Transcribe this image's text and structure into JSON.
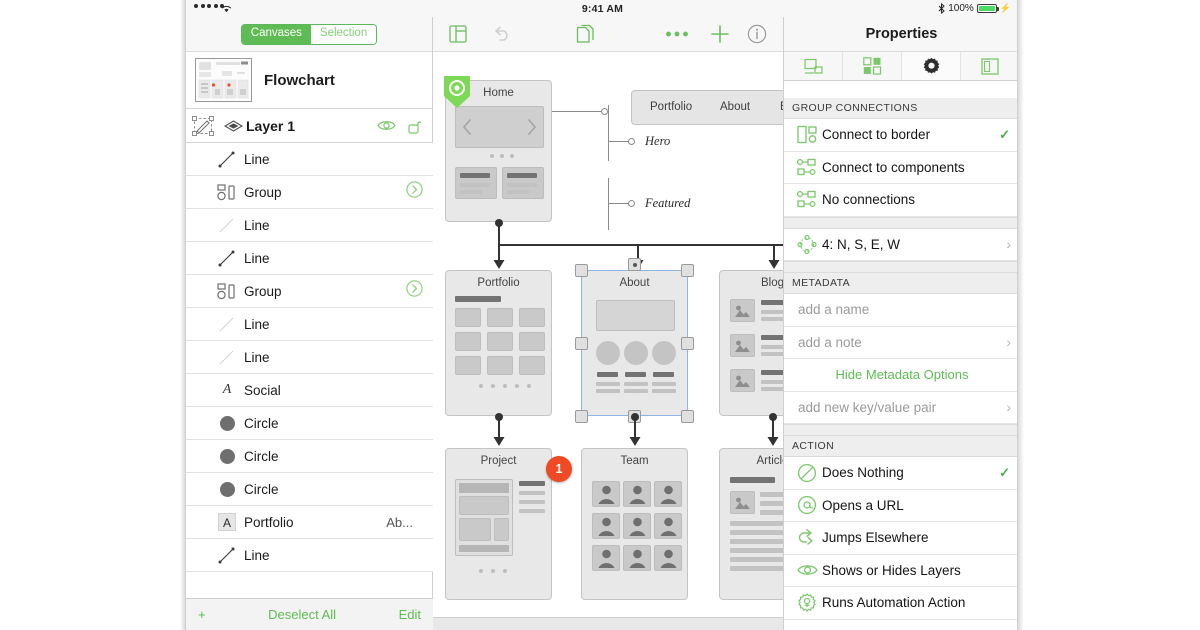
{
  "status_bar": {
    "signal_dots": 5,
    "wifi_icon": "wifi-icon",
    "time": "9:41 AM",
    "bluetooth_icon": "bluetooth-icon",
    "battery_percent": "100%",
    "charging_icon": "lightning-bolt-icon"
  },
  "sidebar": {
    "segmented": {
      "canvases": "Canvases",
      "selection": "Selection",
      "active": "Canvases"
    },
    "canvas": {
      "title": "Flowchart",
      "thumbnail_icon": "canvas-thumbnail"
    },
    "layer": {
      "name": "Layer 1",
      "select_icon": "layer-select-icon",
      "visibility_icon": "eye-icon",
      "lock_icon": "unlocked-padlock-icon"
    },
    "items": [
      {
        "label": "Line",
        "icon": "line-icon",
        "disclosure": false,
        "dim": false,
        "sub": ""
      },
      {
        "label": "Group",
        "icon": "group-icon",
        "disclosure": true,
        "dim": false,
        "sub": ""
      },
      {
        "label": "Line",
        "icon": "line-icon",
        "disclosure": false,
        "dim": true,
        "sub": ""
      },
      {
        "label": "Line",
        "icon": "line-icon",
        "disclosure": false,
        "dim": false,
        "sub": ""
      },
      {
        "label": "Group",
        "icon": "group-icon",
        "disclosure": true,
        "dim": false,
        "sub": ""
      },
      {
        "label": "Line",
        "icon": "line-icon",
        "disclosure": false,
        "dim": true,
        "sub": ""
      },
      {
        "label": "Line",
        "icon": "line-icon",
        "disclosure": false,
        "dim": true,
        "sub": ""
      },
      {
        "label": "Social",
        "icon": "text-italic-icon",
        "disclosure": false,
        "dim": false,
        "sub": ""
      },
      {
        "label": "Circle",
        "icon": "circle-icon",
        "disclosure": false,
        "dim": false,
        "sub": ""
      },
      {
        "label": "Circle",
        "icon": "circle-icon",
        "disclosure": false,
        "dim": false,
        "sub": ""
      },
      {
        "label": "Circle",
        "icon": "circle-icon",
        "disclosure": false,
        "dim": false,
        "sub": ""
      },
      {
        "label": "Portfolio",
        "icon": "text-box-icon",
        "disclosure": false,
        "dim": false,
        "sub": "Ab..."
      },
      {
        "label": "Line",
        "icon": "line-icon",
        "disclosure": false,
        "dim": false,
        "sub": ""
      }
    ],
    "footer": {
      "add_label": "+",
      "deselect_label": "Deselect All",
      "edit_label": "Edit"
    }
  },
  "toolbar": {
    "sidebar_toggle_icon": "sidebar-toggle-icon",
    "undo_icon": "undo-arrow-icon",
    "documents_icon": "documents-icon",
    "more_icon": "more-ellipsis-icon",
    "add_icon": "plus-icon",
    "info_icon": "info-circle-icon"
  },
  "canvas": {
    "start_badge_icon": "start-marker-icon",
    "annotation_badge": "1",
    "cards": [
      {
        "title": "Home",
        "kind": "hero"
      },
      {
        "title": "Portfolio",
        "kind": "grid"
      },
      {
        "title": "About",
        "kind": "team-about",
        "selected": true
      },
      {
        "title": "Blog",
        "kind": "list"
      },
      {
        "title": "Project",
        "kind": "detail"
      },
      {
        "title": "Team",
        "kind": "avatars"
      },
      {
        "title": "Article",
        "kind": "article"
      }
    ],
    "nav_card": {
      "items": [
        "Portfolio",
        "About",
        "Bl"
      ]
    },
    "callouts": [
      "Hero",
      "Featured"
    ]
  },
  "properties": {
    "title": "Properties",
    "tabs": [
      {
        "name": "object-tab",
        "icon": "object-geometry-icon",
        "active": false
      },
      {
        "name": "connections-tab",
        "icon": "connections-icon",
        "active": false
      },
      {
        "name": "settings-tab",
        "icon": "gear-icon",
        "active": true
      },
      {
        "name": "canvas-tab",
        "icon": "canvas-layout-icon",
        "active": false
      }
    ],
    "group_connections": {
      "header": "GROUP CONNECTIONS",
      "options": [
        {
          "label": "Connect to border",
          "icon": "connect-border-icon",
          "checked": true
        },
        {
          "label": "Connect to components",
          "icon": "connect-components-icon",
          "checked": false
        },
        {
          "label": "No connections",
          "icon": "no-connections-icon",
          "checked": false
        }
      ],
      "magnets": {
        "label": "4: N, S, E, W",
        "icon": "magnets-icon",
        "chevron": "›"
      }
    },
    "metadata": {
      "header": "METADATA",
      "name_placeholder": "add a name",
      "note_placeholder": "add a note",
      "hide_options_label": "Hide Metadata Options",
      "key_value_placeholder": "add new key/value pair",
      "chevron": "›"
    },
    "action": {
      "header": "ACTION",
      "options": [
        {
          "label": "Does Nothing",
          "icon": "no-action-icon",
          "checked": true
        },
        {
          "label": "Opens a URL",
          "icon": "at-sign-icon",
          "checked": false
        },
        {
          "label": "Jumps Elsewhere",
          "icon": "jump-arrow-icon",
          "checked": false
        },
        {
          "label": "Shows or Hides Layers",
          "icon": "eye-icon",
          "checked": false
        },
        {
          "label": "Runs Automation Action",
          "icon": "automation-gear-icon",
          "checked": false
        }
      ]
    }
  },
  "colors": {
    "accent_green": "#5fbb53",
    "icon_green": "#7ac86a",
    "badge_red": "#f04a24",
    "selection_blue": "#8cb6df",
    "panel_gray": "#f7f7f7"
  }
}
